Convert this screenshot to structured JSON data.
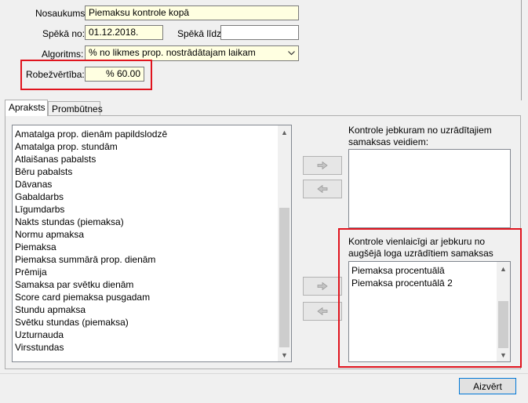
{
  "header": {
    "nosaukums_label": "Nosaukums:",
    "nosaukums_value": "Piemaksu kontrole kopā",
    "speka_no_label": "Spēkā no:",
    "speka_no_value": "01.12.2018.",
    "speka_lidz_label": "Spēkā līdz:",
    "speka_lidz_value": "",
    "algoritms_label": "Algoritms:",
    "algoritms_value": "% no likmes prop. nostrādātajam laikam",
    "robezvertiba_label": "Robežvērtība:",
    "robezvertiba_value": "% 60.00"
  },
  "tabs": [
    {
      "label": "Apraksts",
      "active": true
    },
    {
      "label": "Prombūtnes",
      "active": false
    }
  ],
  "left_list": {
    "items": [
      "Amatalga prop. dienām papildslodzē",
      "Amatalga prop. stundām",
      "Atlaišanas pabalsts",
      "Bēru pabalsts",
      "Dāvanas",
      "Gabaldarbs",
      "Līgumdarbs",
      "Nakts stundas (piemaksa)",
      "Normu apmaksa",
      "Piemaksa",
      "Piemaksa summārā prop. dienām",
      "Prēmija",
      "Samaksa par svētku dienām",
      "Score card piemaksa pusgadam",
      "Stundu apmaksa",
      "Svētku stundas (piemaksa)",
      "Uzturnauda",
      "Virsstundas"
    ]
  },
  "right_top": {
    "title": "Kontrole jebkuram no uzrādītajiem samaksas veidiem:",
    "items": []
  },
  "right_bottom": {
    "title": "Kontrole vienlaicīgi ar jebkuru no augšējā loga uzrādītiem samaksas veidiem:",
    "items": [
      "Piemaksa procentuālā",
      "Piemaksa procentuālā 2"
    ]
  },
  "footer": {
    "close_label": "Aizvērt"
  },
  "colors": {
    "highlight_border": "#e0141e",
    "yellow_field": "#ffffe1",
    "focus_border": "#0078d7"
  }
}
